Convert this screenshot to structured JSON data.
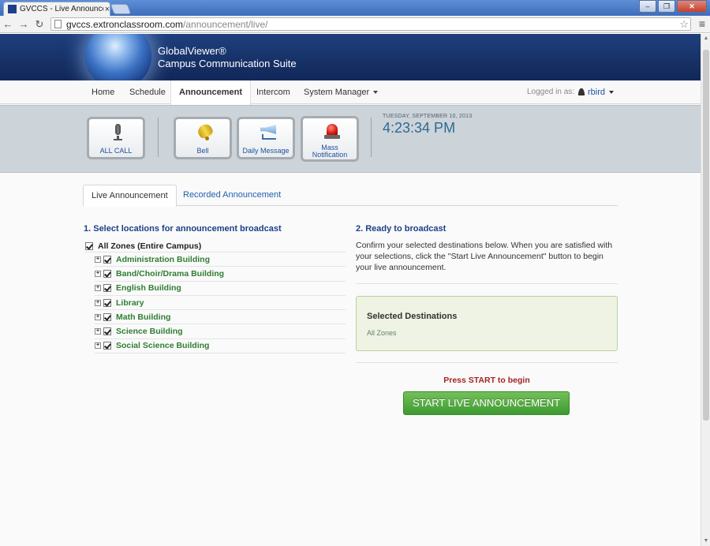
{
  "browser": {
    "tab_title": "GVCCS - Live Announcem",
    "tab_close": "×",
    "url_host": "gvccs.extronclassroom.com",
    "url_path": "/announcement/live/",
    "back": "←",
    "forward": "→",
    "reload": "↻",
    "star": "☆",
    "menu": "≡",
    "window_buttons": {
      "minimize": "–",
      "maximize": "❐",
      "close": "✕"
    }
  },
  "brand": {
    "name": "GlobalViewer®",
    "subtitle": "Campus Communication Suite"
  },
  "nav": {
    "items": [
      "Home",
      "Schedule",
      "Announcement",
      "Intercom",
      "System Manager"
    ],
    "active": "Announcement",
    "logged_in_label": "Logged in as:",
    "username": "rbird"
  },
  "quick_actions": [
    {
      "label": "ALL CALL",
      "icon": "microphone-icon"
    },
    {
      "label": "Bell",
      "icon": "bell-icon"
    },
    {
      "label": "Daily Message",
      "icon": "megaphone-icon"
    },
    {
      "label": "Mass Notification",
      "icon": "siren-icon"
    }
  ],
  "clock": {
    "date": "TUESDAY, SEPTEMBER 10, 2013",
    "time": "4:23:34 PM"
  },
  "tabs": [
    "Live Announcement",
    "Recorded Announcement"
  ],
  "locations": {
    "title": "1. Select locations for announcement broadcast",
    "root": "All Zones (Entire Campus)",
    "buildings": [
      "Administration Building",
      "Band/Choir/Drama Building",
      "English Building",
      "Library",
      "Math Building",
      "Science Building",
      "Social Science Building"
    ]
  },
  "broadcast": {
    "title": "2. Ready to broadcast",
    "instructions": "Confirm your selected destinations below. When you are satisfied with your selections, click the \"Start Live Announcement\" button to begin your live announcement.",
    "destinations_title": "Selected Destinations",
    "destinations_value": "All Zones",
    "prompt": "Press START to begin",
    "start_button": "START LIVE ANNOUNCEMENT"
  },
  "colors": {
    "banner": "#163166",
    "accent_blue": "#1d3f86",
    "building_green": "#2f7d32",
    "start_green": "#3d9a31",
    "prompt_red": "#a52323"
  }
}
